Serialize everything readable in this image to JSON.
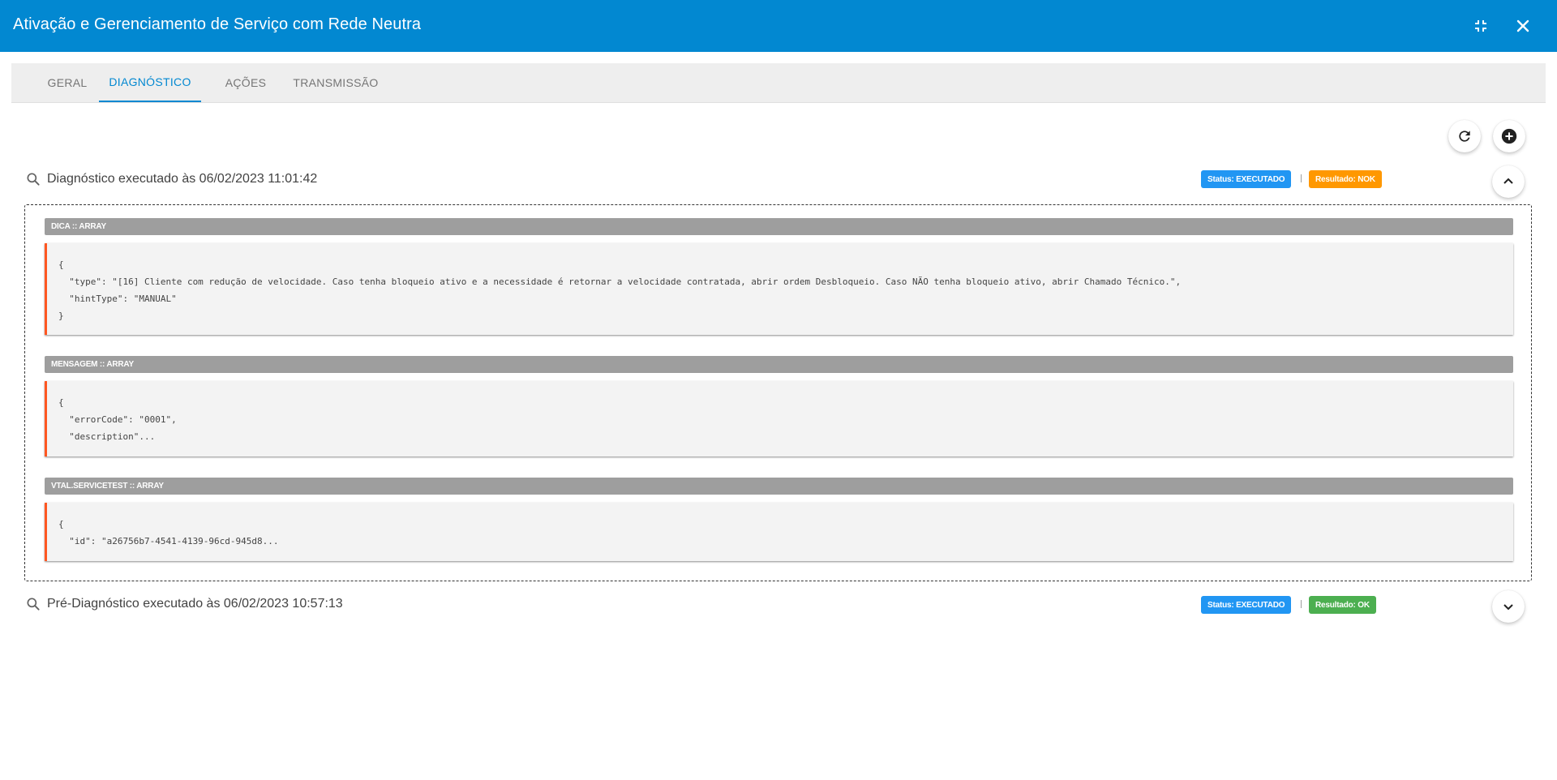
{
  "window": {
    "title": "Ativação e Gerenciamento de Serviço com Rede Neutra",
    "minimize_icon": "collapse-arrows-icon",
    "close_icon": "close-icon"
  },
  "tabs": [
    {
      "label": "GERAL",
      "active": false
    },
    {
      "label": "DIAGNÓSTICO",
      "active": true
    },
    {
      "label": "AÇÕES",
      "active": false
    },
    {
      "label": "TRANSMISSÃO",
      "active": false
    }
  ],
  "toolbar": {
    "refresh_icon": "refresh-icon",
    "add_icon": "add-circle-icon"
  },
  "colors": {
    "header": "#0288d1",
    "status_badge": "#2196f3",
    "nok_badge": "#ff9800",
    "ok_badge": "#4caf50",
    "code_accent": "#ff5722"
  },
  "diagnostics": [
    {
      "title": "Diagnóstico executado às 06/02/2023 11:01:42",
      "status": "Status: EXECUTADO",
      "separator": "|",
      "result": "Resultado: NOK",
      "expanded": true,
      "sections": [
        {
          "label": "DICA :: ARRAY",
          "lines": [
            "{",
            "  \"type\": \"[16] Cliente com redução de velocidade. Caso tenha bloqueio ativo e a necessidade é retornar a velocidade contratada, abrir ordem Desbloqueio. Caso NÃO tenha bloqueio ativo, abrir Chamado Técnico.\",",
            "  \"hintType\": \"MANUAL\"",
            "}"
          ]
        },
        {
          "label": "MENSAGEM :: ARRAY",
          "lines": [
            "{",
            "  \"errorCode\": \"0001\",",
            "  \"description\"..."
          ]
        },
        {
          "label": "VTAL.SERVICETEST :: ARRAY",
          "lines": [
            "{",
            "  \"id\": \"a26756b7-4541-4139-96cd-945d8..."
          ]
        }
      ]
    },
    {
      "title": "Pré-Diagnóstico executado às 06/02/2023 10:57:13",
      "status": "Status: EXECUTADO",
      "separator": "|",
      "result": "Resultado: OK",
      "expanded": false
    }
  ]
}
